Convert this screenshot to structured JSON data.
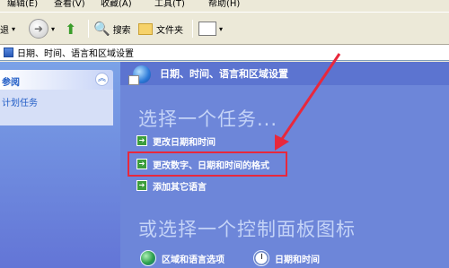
{
  "menubar": {
    "items": [
      "编辑(E)",
      "查看(V)",
      "收藏(A)",
      "工具(T)",
      "帮助(H)"
    ]
  },
  "toolbar": {
    "back_label": "退",
    "search_label": "搜索",
    "folders_label": "文件夹"
  },
  "addressbar": {
    "path": "日期、时间、语言和区域设置"
  },
  "left_pane": {
    "header": "参阅",
    "link": "计划任务"
  },
  "main": {
    "title": "日期、时间、语言和区域设置",
    "task_heading": "选择一个任务...",
    "tasks": [
      "更改日期和时间",
      "更改数字、日期和时间的格式",
      "添加其它语言"
    ],
    "panel_heading": "或选择一个控制面板图标",
    "icons": [
      "区域和语言选项",
      "日期和时间"
    ]
  },
  "colors": {
    "highlight": "#E8283C",
    "main_bg": "#6D86D9",
    "task_arrow": "#3C9D3C"
  }
}
